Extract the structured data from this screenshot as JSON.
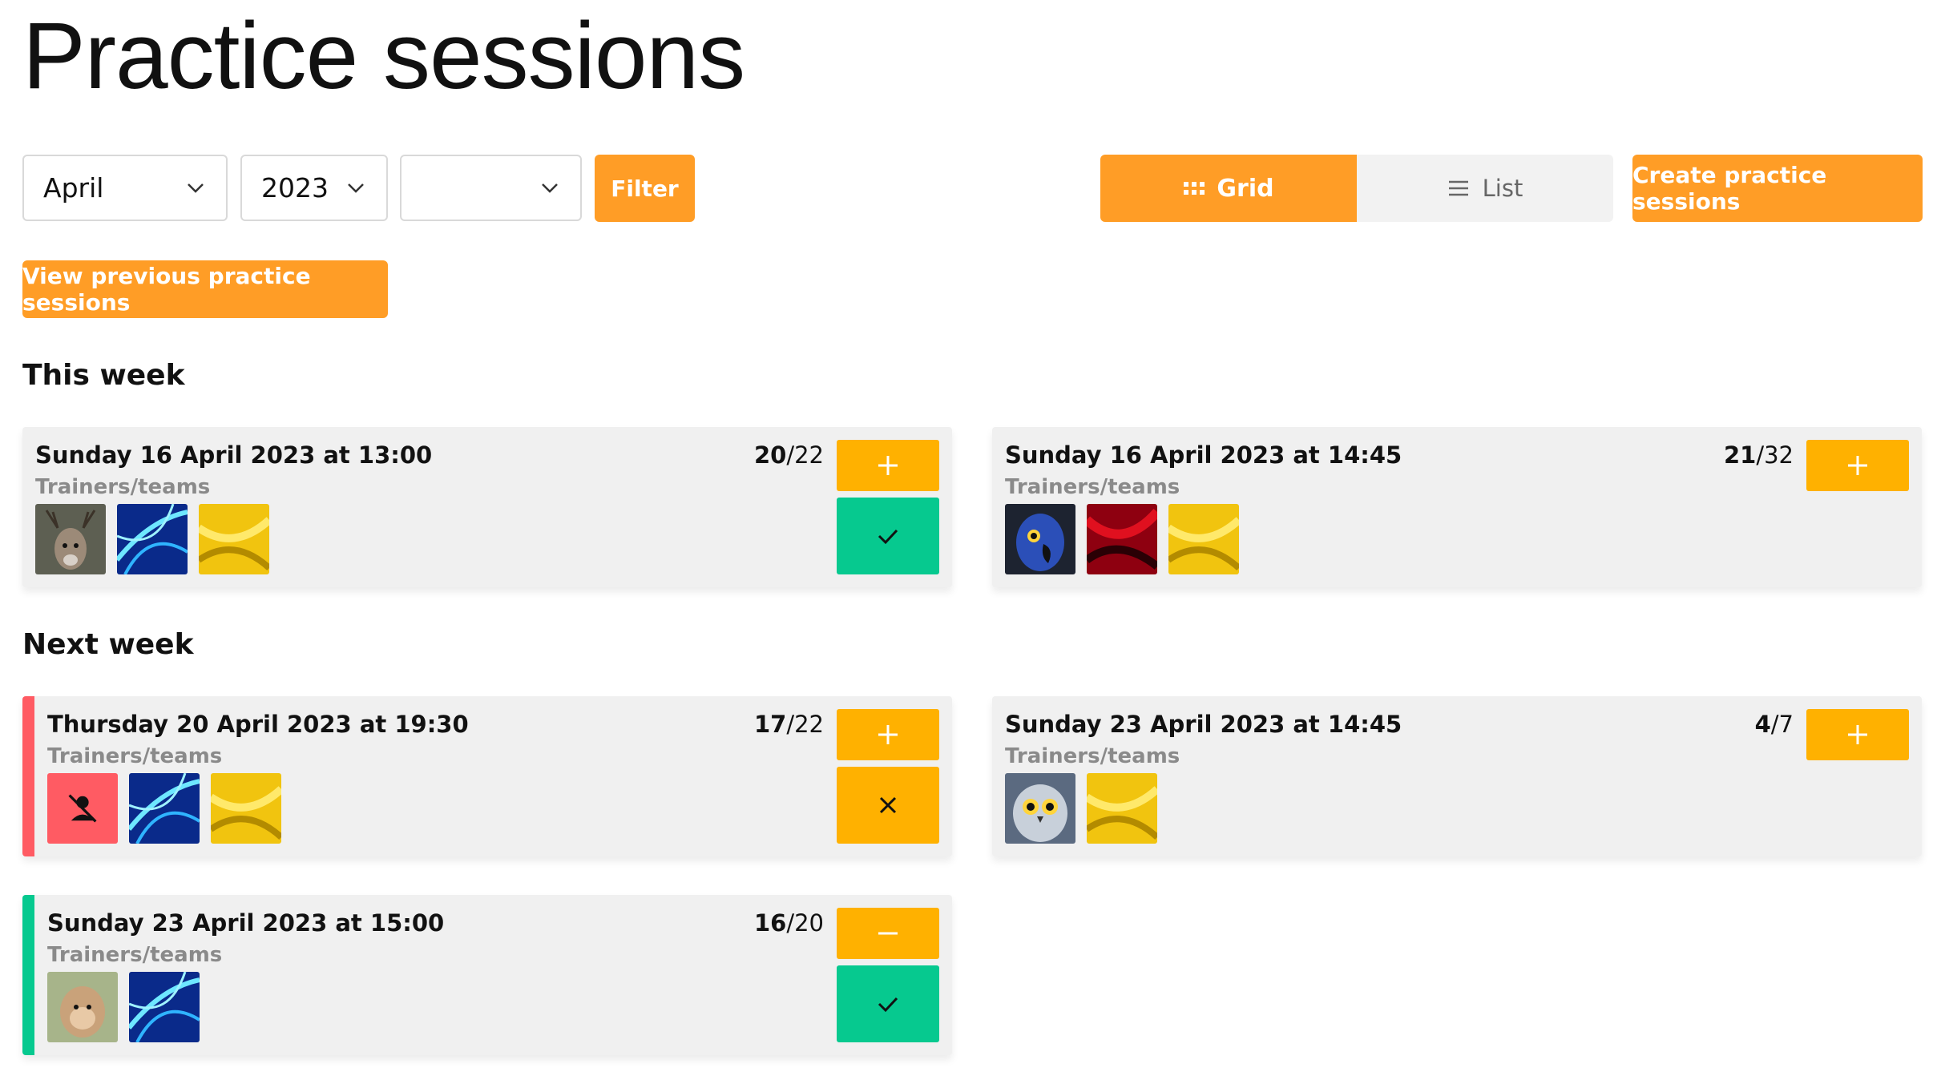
{
  "page": {
    "title": "Practice sessions"
  },
  "filters": {
    "month": "April",
    "year": "2023",
    "extra": "",
    "filter_label": "Filter"
  },
  "view_toggle": {
    "grid_label": "Grid",
    "list_label": "List",
    "active": "Grid"
  },
  "create_label": "Create practice sessions",
  "previous_label": "View previous practice sessions",
  "colors": {
    "accent": "#ff9d26",
    "yellow": "#ffb100",
    "green": "#06c98f",
    "red": "#ff5b63"
  },
  "sections": [
    {
      "heading": "This week",
      "sessions": [
        {
          "date": "Sunday 16 April 2023 at 13:00",
          "subtitle": "Trainers/teams",
          "count_current": "20",
          "count_total": "/22",
          "thumbs": [
            "deer",
            "blue-light",
            "gold"
          ],
          "action_top": "plus-icon",
          "action_bottom": "check-icon"
        },
        {
          "date": "Sunday 16 April 2023 at 14:45",
          "subtitle": "Trainers/teams",
          "count_current": "21",
          "count_total": "/32",
          "thumbs": [
            "parrot",
            "red-silk",
            "gold"
          ],
          "action_top": "plus-icon",
          "action_bottom": ""
        }
      ]
    },
    {
      "heading": "Next week",
      "sessions": [
        {
          "date": "Thursday 20 April 2023 at 19:30",
          "subtitle": "Trainers/teams",
          "count_current": "17",
          "count_total": "/22",
          "thumbs": [
            "user-off",
            "blue-light",
            "gold"
          ],
          "action_top": "plus-icon",
          "action_bottom": "close-icon",
          "stripe": "red"
        },
        {
          "date": "Sunday 23 April 2023 at 14:45",
          "subtitle": "Trainers/teams",
          "count_current": "4",
          "count_total": "/7",
          "thumbs": [
            "owl",
            "gold"
          ],
          "action_top": "plus-icon",
          "action_bottom": ""
        },
        {
          "date": "Sunday 23 April 2023 at 15:00",
          "subtitle": "Trainers/teams",
          "count_current": "16",
          "count_total": "/20",
          "thumbs": [
            "monkey",
            "blue-light"
          ],
          "action_top": "minus-icon",
          "action_bottom": "check-icon",
          "stripe": "green"
        }
      ]
    }
  ]
}
